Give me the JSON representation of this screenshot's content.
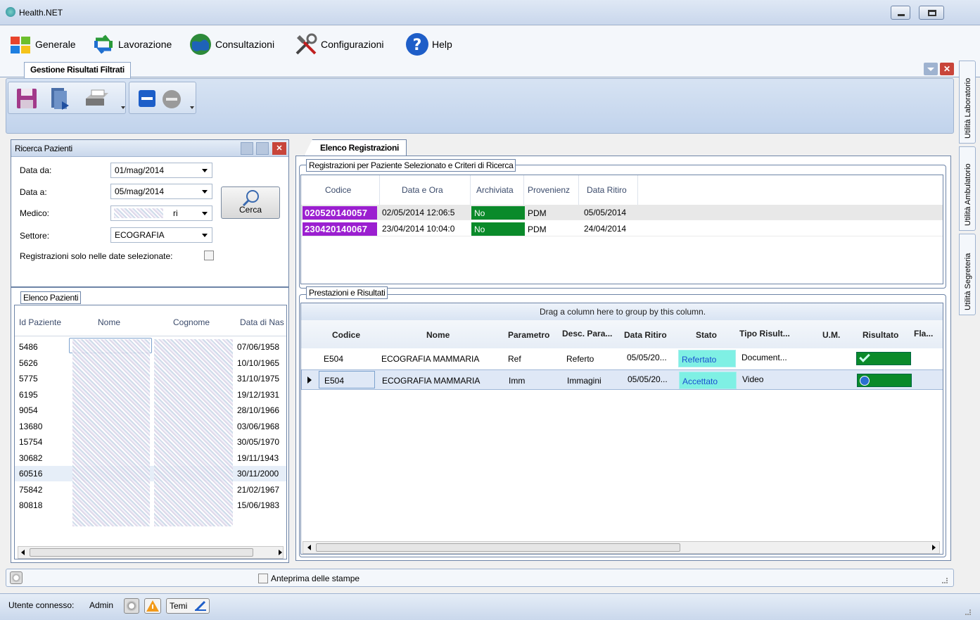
{
  "app": {
    "title": "Health.NET"
  },
  "menu": [
    {
      "label": "Generale",
      "icon": "windows-flag-icon"
    },
    {
      "label": "Lavorazione",
      "icon": "sync-arrows-icon"
    },
    {
      "label": "Consultazioni",
      "icon": "globe-icon"
    },
    {
      "label": "Configurazioni",
      "icon": "tools-icon"
    },
    {
      "label": "Help",
      "icon": "help-icon"
    }
  ],
  "doc_tab": {
    "label": "Gestione Risultati Filtrati"
  },
  "side_tabs": [
    "Utilità Laboratorio",
    "Utilità Ambulatorio",
    "Utilità Segreteria"
  ],
  "search": {
    "title": "Ricerca Pazienti",
    "data_da_label": "Data da:",
    "data_da_value": "01/mag/2014",
    "data_a_label": "Data a:",
    "data_a_value": "05/mag/2014",
    "medico_label": "Medico:",
    "medico_value": "ri",
    "settore_label": "Settore:",
    "settore_value": "ECOGRAFIA",
    "solo_date_label": "Registrazioni solo nelle date selezionate:",
    "cerca_label": "Cerca"
  },
  "patients": {
    "title": "Elenco Pazienti",
    "columns": [
      "Id Paziente",
      "Nome",
      "Cognome",
      "Data di Nas"
    ],
    "rows": [
      {
        "id": "5486",
        "birth": "07/06/1958"
      },
      {
        "id": "5626",
        "birth": "10/10/1965"
      },
      {
        "id": "5775",
        "birth": "31/10/1975"
      },
      {
        "id": "6195",
        "birth": "19/12/1931"
      },
      {
        "id": "9054",
        "birth": "28/10/1966"
      },
      {
        "id": "13680",
        "birth": "03/06/1968"
      },
      {
        "id": "15754",
        "birth": "30/05/1970"
      },
      {
        "id": "30682",
        "birth": "19/11/1943"
      },
      {
        "id": "60516",
        "birth": "30/11/2000"
      },
      {
        "id": "75842",
        "birth": "21/02/1967"
      },
      {
        "id": "80818",
        "birth": "15/06/1983"
      }
    ]
  },
  "registrations": {
    "tab_label": "Elenco Registrazioni",
    "group_title": "Registrazioni per Paziente Selezionato e Criteri di Ricerca",
    "columns": [
      "Codice",
      "Data e Ora",
      "Archiviata",
      "Provenienz",
      "Data Ritiro"
    ],
    "rows": [
      {
        "codice": "020520140057",
        "data": "02/05/2014 12:06:5",
        "archiviata": "No",
        "prov": "PDM",
        "ritiro": "05/05/2014"
      },
      {
        "codice": "230420140067",
        "data": "23/04/2014 10:04:0",
        "archiviata": "No",
        "prov": "PDM",
        "ritiro": "24/04/2014"
      }
    ]
  },
  "results": {
    "group_title": "Prestazioni e Risultati",
    "group_hint": "Drag a column here to group by this column.",
    "columns": [
      "Codice",
      "Nome",
      "Parametro",
      "Desc. Para...",
      "Data Ritiro",
      "Stato",
      "Tipo Risult...",
      "U.M.",
      "Risultato",
      "Fla..."
    ],
    "rows": [
      {
        "codice": "E504",
        "nome": "ECOGRAFIA MAMMARIA",
        "param": "Ref",
        "desc": "Referto",
        "ritiro": "05/05/20...",
        "stato": "Refertato",
        "tipo": "Document...",
        "um": "",
        "risultato": "check-icon"
      },
      {
        "codice": "E504",
        "nome": "ECOGRAFIA MAMMARIA",
        "param": "Imm",
        "desc": "Immagini",
        "ritiro": "05/05/20...",
        "stato": "Accettato",
        "tipo": "Video",
        "um": "",
        "risultato": "play-icon"
      }
    ]
  },
  "status": {
    "preview_label": "Anteprima delle stampe"
  },
  "bottom": {
    "user_label": "Utente connesso:",
    "user_value": "Admin",
    "temi_label": "Temi"
  },
  "colors": {
    "accent_purple": "#9b1fd0",
    "status_green": "#0a8a2a",
    "stato_cyan": "#7ff0e4"
  }
}
